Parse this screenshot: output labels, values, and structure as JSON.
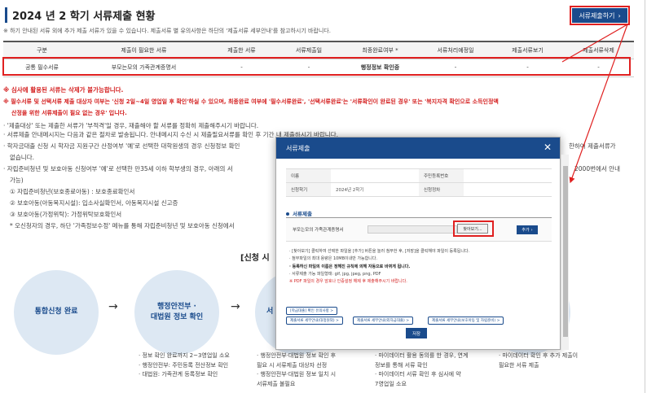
{
  "header": {
    "title": "2024 년 2 학기 서류제출 현황",
    "submit_button": "서류제출하기",
    "notice": "※ 하기 안내된 서류 외에 추가 제출 서류가 있을 수 있습니다. 제출서류 별 유의사항은 하단의 '제출서류 세부안내'를 참고하시기 바랍니다."
  },
  "table": {
    "columns": [
      "구분",
      "제출이 필요한 서류",
      "제출한 서류",
      "서류제출일",
      "최종완료여부 *",
      "서류처리예정일",
      "제출서류보기",
      "제출서류삭제"
    ],
    "rows": [
      [
        "공통 필수서류",
        "부모는모의 가족관계증명서",
        "-",
        "-",
        "행정정보 확인중",
        "-",
        "-",
        "-"
      ]
    ]
  },
  "notes": {
    "red1": "※ 심사에 활용된 서류는 삭제가 불가능합니다.",
    "red2": "※ 필수서류 및 선택서류 제출 대상자 여부는 '신청 2일~4일 영업일 후 확인'하실 수 있으며, 최종완료 여부에 '필수서류완료', '선택서류완료'는 '서류확인이 완료된 경우' 또는 '복지자격 확인으로 소득인정액",
    "red3": "산정을 위한 서류제출이 필요 없는 경우' 입니다.",
    "n1": "· '제출대상' 또는 제출한 서류가 '부적격'일 경우, 재출해야 할 서류를 정확히 제출해주시기 바랍니다.",
    "n2": "· 서류제출 안내메시지는 다음과 같은 절차로 발송됩니다. 안내메시지 수신 시 제출필요서류를 확인 후 기간 내 제출하시기 바랍니다.",
    "n3": "· 학자금대출 신청 시 학자금 지원구간 산정여부 '예'로 선택한 대학원생의 경우 신청정보 확인",
    "n3b": "한하여 제출서류가",
    "n4": "없습니다.",
    "n5": "· 자립준비청년 및 보호아동 신청여부 '예'로 선택한 만35세 이하 학부생의 경우, 아래의 서",
    "n5b": "2000번에서 안내",
    "n6": "가능)",
    "n7": "① 자립준비청년(보호종료아동) : 보호종료확인서",
    "n8": "② 보호아동(아동복지시설): 입소사실확인서, 아동복지시설 신고증",
    "n9": "③ 보호아동(가정위탁): 가정위탁보호확인서",
    "n10": "* 오신청자의 경우, 하단 '가족정보수정' 메뉴를 통해 자립준비청년 및 보호아동 신청에서"
  },
  "flow": {
    "heading": "[신청 시",
    "step1": "통합신청 완료",
    "step2_line1": "행정안전부 ·",
    "step2_line2": "대법원 정보 확인",
    "step3": "서",
    "arrow": "→"
  },
  "descriptions": {
    "d1": [
      "· 정보 확인 완료까지 2~3영업일 소요",
      "· 행정안전부: 주민등록 전산정보 확인",
      "· 대법원: 가족관계 등록정보 확인"
    ],
    "d2": [
      "· 행정안전부·대법원 정보 확인 후",
      "필요 시 서류제출 대상자 선정",
      "· 행정안전부·대법원 정보 일치 시",
      "서류제출 불필요"
    ],
    "d3": [
      "· 마이데이터 활용 동의를 한 경우, 연계",
      "정보를 통해 서류 확인",
      "· 마이데이터 서류 확인 후 심사에 약",
      "7영업일 소요"
    ],
    "d4": [
      "· 마이데이터 확인 후 추가 제출이",
      "필요한 서류 제출"
    ]
  },
  "modal": {
    "title": "서류제출",
    "close": "✕",
    "info": {
      "name_label": "이름",
      "id_label": "주민등록번호",
      "term_label": "신청학기",
      "term_value": "2024년 2학기",
      "status_label": "신청정차"
    },
    "section": "서류제출",
    "upload_label": "부모는모의 가족관계증명서",
    "browse_button": "찾아보기...",
    "add_button": "추가",
    "notes": [
      "· [찾아보기] 클릭하여 선택한 파일을 [추가] 버튼을 눌러 첨부한 후, [저장]을 클릭해야 파일이 등록됩니다.",
      "· 첨부파일의 최대 용량은 10MB이내만 가능합니다.",
      "· 등록하신 파일의 이름은 정해진 규칙에 의해 자동으로 바뀌게 됩니다.",
      "· 서류제출 가능 파일형태: gif, jpg, jpeg, png, PDF",
      "※ PDF 파일의 경우 암호나 인증설정 해제 후 제출해주시기 바랍니다."
    ],
    "links": [
      "[학금대출] 확인 유의사항 >",
      "제출서류 세부안내(대청원외) >",
      "제출서류 세부안내(외자금대출) >",
      "제출서류 세부안내(보호아동 및 자립준비) >"
    ],
    "confirm_button": "저장"
  },
  "colors": {
    "primary": "#1a4b8c",
    "annotation": "#e02020",
    "flow_circle": "#dde8f3"
  }
}
